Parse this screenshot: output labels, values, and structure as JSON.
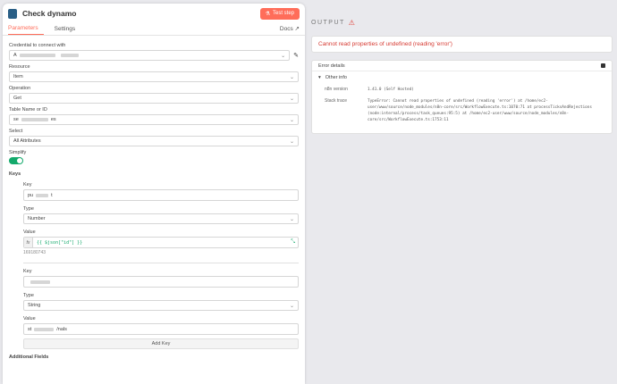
{
  "node": {
    "title": "Check dynamo",
    "test_label": "Test step"
  },
  "tabs": {
    "parameters": "Parameters",
    "settings": "Settings",
    "docs": "Docs"
  },
  "credential": {
    "label": "Credential to connect with",
    "value": "A"
  },
  "resource": {
    "label": "Resource",
    "value": "Item"
  },
  "operation": {
    "label": "Operation",
    "value": "Get"
  },
  "table": {
    "label": "Table Name or ID",
    "value_a": "se",
    "value_b": "es"
  },
  "select": {
    "label": "Select",
    "value": "All Attributes"
  },
  "simplify": {
    "label": "Simplify",
    "on": true
  },
  "keys": {
    "label": "Keys",
    "items": [
      {
        "key_label": "Key",
        "key_value_a": "pu",
        "key_value_b": "t",
        "type_label": "Type",
        "type_value": "Number",
        "value_label": "Value",
        "expr_value": "{{ $json[\"id\"] }}",
        "value_hint": "169180743"
      },
      {
        "key_label": "Key",
        "type_label": "Type",
        "type_value": "String",
        "value_label": "Value",
        "value_a": "st",
        "value_b": "/nals"
      }
    ],
    "add_label": "Add Key"
  },
  "additional_fields": "Additional Fields",
  "output": {
    "title": "OUTPUT",
    "error": "Cannot read properties of undefined (reading 'error')",
    "details_label": "Error details",
    "other_info": "Other info",
    "n8n_version_label": "n8n version",
    "n8n_version": "1.41.0 (Self Hosted)",
    "stack_label": "Stack trace",
    "stack": "TypeError: Cannot read properties of undefined (reading 'error') at /home/ec2-user/www/source/node_modules/n8n-core/src/WorkflowExecute.ts:1070:71 at processTicksAndRejections (node:internal/process/task_queues:95:5) at /home/ec2-user/www/source/node_modules/n8n-core/src/WorkflowExecute.ts:1753:11"
  }
}
